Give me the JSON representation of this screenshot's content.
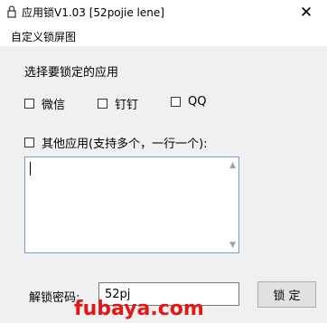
{
  "window": {
    "title": "应用锁V1.03 [52pojie lene]",
    "icon": "lock-icon",
    "close_glyph": "✕"
  },
  "menu": {
    "items": [
      {
        "label": "自定义锁屏图"
      }
    ]
  },
  "apps_section": {
    "heading": "选择要锁定的应用",
    "options": [
      {
        "label": "微信",
        "checked": false
      },
      {
        "label": "钉钉",
        "checked": false
      },
      {
        "label": "QQ",
        "checked": false
      }
    ],
    "other_label": "其他应用(支持多个，一行一个):",
    "other_checked": false,
    "other_text": ""
  },
  "password": {
    "label": "解锁密码:",
    "value": "52pj"
  },
  "lock_button": "锁 定",
  "watermark": "fubaya.com"
}
